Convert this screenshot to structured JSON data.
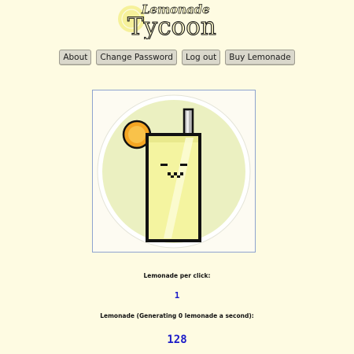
{
  "logo": {
    "line1": "Lemonade",
    "line2": "Tycoon"
  },
  "nav": {
    "about": "About",
    "change_password": "Change Password",
    "logout": "Log out",
    "buy": "Buy Lemonade"
  },
  "stats": {
    "per_click_label": "Lemonade per click:",
    "per_click_value": "1",
    "total_label": "Lemonade (Generating 0 lemonade a second):",
    "total_value": "128"
  },
  "colors": {
    "background": "#fefbe2",
    "stat_value": "#1b1bc8",
    "lemonade": "#f4f4a0",
    "lemon": "#f5a623"
  }
}
